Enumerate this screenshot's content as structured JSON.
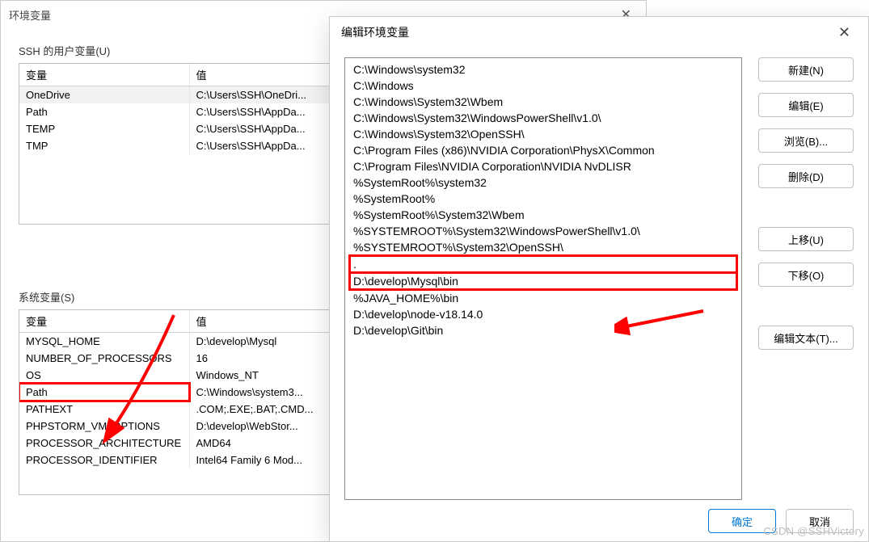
{
  "parentWindow": {
    "title": "环境变量",
    "userSection": {
      "label": "SSH 的用户变量(U)",
      "headers": {
        "var": "变量",
        "val": "值"
      },
      "rows": [
        {
          "var": "OneDrive",
          "val": "C:\\Users\\SSH\\OneDri..."
        },
        {
          "var": "Path",
          "val": "C:\\Users\\SSH\\AppDa..."
        },
        {
          "var": "TEMP",
          "val": "C:\\Users\\SSH\\AppDa..."
        },
        {
          "var": "TMP",
          "val": "C:\\Users\\SSH\\AppDa..."
        }
      ],
      "selectedIndex": 0
    },
    "sysSection": {
      "label": "系统变量(S)",
      "headers": {
        "var": "变量",
        "val": "值"
      },
      "rows": [
        {
          "var": "MYSQL_HOME",
          "val": "D:\\develop\\Mysql"
        },
        {
          "var": "NUMBER_OF_PROCESSORS",
          "val": "16"
        },
        {
          "var": "OS",
          "val": "Windows_NT"
        },
        {
          "var": "Path",
          "val": "C:\\Windows\\system3..."
        },
        {
          "var": "PATHEXT",
          "val": ".COM;.EXE;.BAT;.CMD..."
        },
        {
          "var": "PHPSTORM_VM_OPTIONS",
          "val": "D:\\develop\\WebStor..."
        },
        {
          "var": "PROCESSOR_ARCHITECTURE",
          "val": "AMD64"
        },
        {
          "var": "PROCESSOR_IDENTIFIER",
          "val": "Intel64 Family 6 Mod..."
        }
      ],
      "highlightIndex": 3
    }
  },
  "editWindow": {
    "title": "编辑环境变量",
    "entries": [
      "C:\\Windows\\system32",
      "C:\\Windows",
      "C:\\Windows\\System32\\Wbem",
      "C:\\Windows\\System32\\WindowsPowerShell\\v1.0\\",
      "C:\\Windows\\System32\\OpenSSH\\",
      "C:\\Program Files (x86)\\NVIDIA Corporation\\PhysX\\Common",
      "C:\\Program Files\\NVIDIA Corporation\\NVIDIA NvDLISR",
      "%SystemRoot%\\system32",
      "%SystemRoot%",
      "%SystemRoot%\\System32\\Wbem",
      "%SYSTEMROOT%\\System32\\WindowsPowerShell\\v1.0\\",
      "%SYSTEMROOT%\\System32\\OpenSSH\\",
      ".",
      "D:\\develop\\Mysql\\bin",
      "%JAVA_HOME%\\bin",
      "D:\\develop\\node-v18.14.0",
      "D:\\develop\\Git\\bin"
    ],
    "highlightIndices": [
      12,
      13
    ],
    "buttons": {
      "new": "新建(N)",
      "edit": "编辑(E)",
      "browse": "浏览(B)...",
      "delete": "删除(D)",
      "up": "上移(U)",
      "down": "下移(O)",
      "editText": "编辑文本(T)..."
    },
    "footer": {
      "ok": "确定",
      "cancel": "取消"
    }
  },
  "watermark": "CSDN @SSHVictory"
}
